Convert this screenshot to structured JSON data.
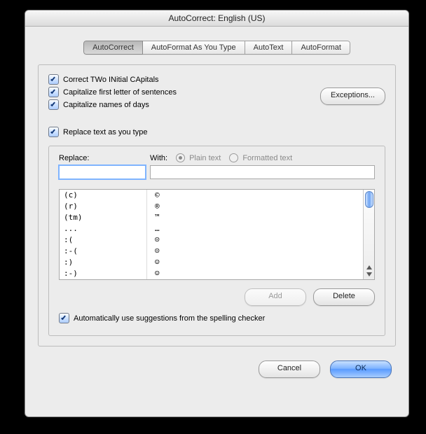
{
  "title": "AutoCorrect: English (US)",
  "tabs": [
    {
      "label": "AutoCorrect",
      "active": true
    },
    {
      "label": "AutoFormat As You Type",
      "active": false
    },
    {
      "label": "AutoText",
      "active": false
    },
    {
      "label": "AutoFormat",
      "active": false
    }
  ],
  "options": {
    "two_initial_caps": "Correct TWo INitial CApitals",
    "capitalize_sentences": "Capitalize first letter of sentences",
    "capitalize_days": "Capitalize names of days"
  },
  "exceptions_btn": "Exceptions...",
  "replace_as_you_type": "Replace text as you type",
  "labels": {
    "replace": "Replace:",
    "with": "With:",
    "plain": "Plain text",
    "formatted": "Formatted text"
  },
  "replace_value": "",
  "with_value": "",
  "entries": [
    {
      "from": "(c)",
      "to": "©"
    },
    {
      "from": "(r)",
      "to": "®"
    },
    {
      "from": "(tm)",
      "to": "™"
    },
    {
      "from": "...",
      "to": "…"
    },
    {
      "from": ":(",
      "to": "☹"
    },
    {
      "from": ":-(",
      "to": "☹"
    },
    {
      "from": ":)",
      "to": "☺"
    },
    {
      "from": ":-)",
      "to": "☺"
    }
  ],
  "add_btn": "Add",
  "delete_btn": "Delete",
  "auto_suggestions": "Automatically use suggestions from the spelling checker",
  "cancel_btn": "Cancel",
  "ok_btn": "OK"
}
